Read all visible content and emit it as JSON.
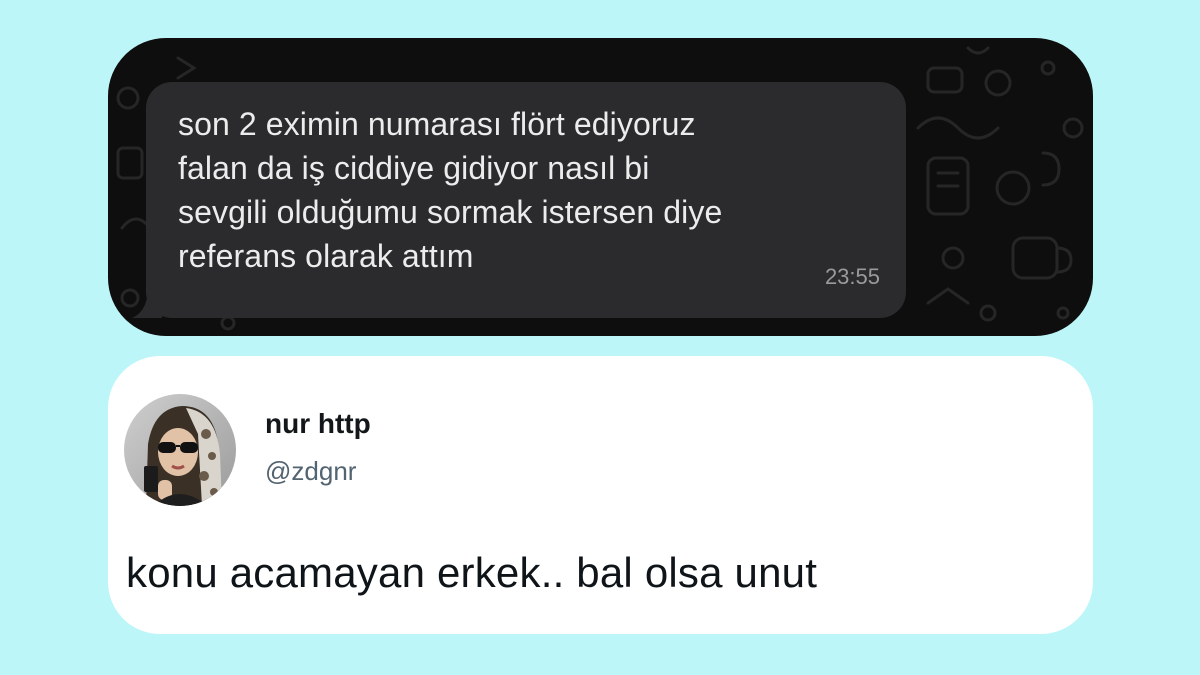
{
  "chat": {
    "message_text": "son 2 eximin numarası flört ediyoruz\nfalan da iş ciddiye gidiyor nasıl bi\nsevgili olduğumu sormak istersen diye\nreferans olarak attım",
    "time": "23:55"
  },
  "tweet": {
    "display_name": "nur http",
    "handle": "@zdgnr",
    "text": "konu acamayan erkek.. bal olsa unut",
    "avatar_icon": "profile-photo-avatar"
  },
  "colors": {
    "page_background": "#bdf6f8",
    "chat_background": "#0e0e0e",
    "chat_bubble": "#2b2b2d",
    "tweet_background": "#ffffff"
  }
}
